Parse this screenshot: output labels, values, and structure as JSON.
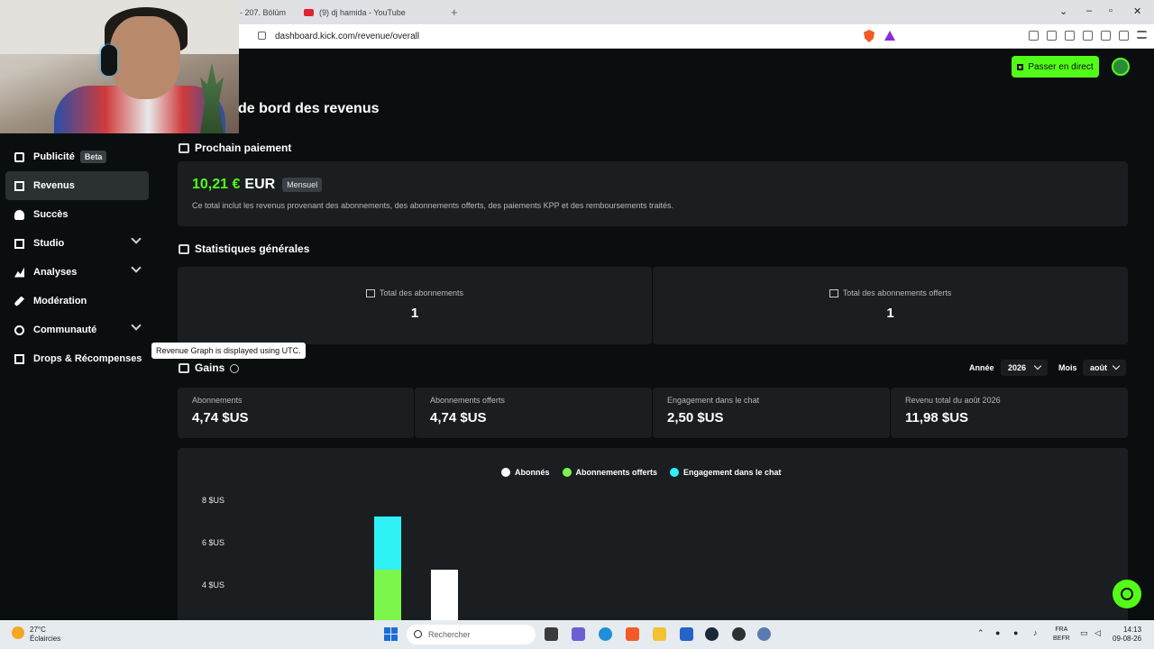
{
  "browser": {
    "tabs": [
      {
        "label": "- 207. Bölüm"
      },
      {
        "label": "(9) dj hamida - YouTube"
      }
    ],
    "url": "dashboard.kick.com/revenue/overall"
  },
  "header": {
    "live_button": "Passer en direct",
    "page_title": "de bord des revenus"
  },
  "sidebar": {
    "items": [
      {
        "label": "Publicité",
        "badge": "Beta"
      },
      {
        "label": "Revenus"
      },
      {
        "label": "Succès"
      },
      {
        "label": "Studio"
      },
      {
        "label": "Analyses"
      },
      {
        "label": "Modération"
      },
      {
        "label": "Communauté"
      },
      {
        "label": "Drops & Récompenses"
      }
    ]
  },
  "next_payment": {
    "title": "Prochain paiement",
    "amount": "10,21 €",
    "currency": "EUR",
    "period": "Mensuel",
    "description": "Ce total inclut les revenus provenant des abonnements, des abonnements offerts, des paiements KPP et des remboursements traités."
  },
  "general_stats": {
    "title": "Statistiques générales",
    "items": [
      {
        "label": "Total des abonnements",
        "value": "1"
      },
      {
        "label": "Total des abonnements offerts",
        "value": "1"
      }
    ]
  },
  "earnings": {
    "title": "Gains",
    "tooltip": "Revenue Graph is displayed using UTC.",
    "year_label": "Année",
    "year_value": "2026",
    "month_label": "Mois",
    "month_value": "août",
    "items": [
      {
        "label": "Abonnements",
        "value": "4,74 $US"
      },
      {
        "label": "Abonnements offerts",
        "value": "4,74 $US"
      },
      {
        "label": "Engagement dans le chat",
        "value": "2,50 $US"
      },
      {
        "label": "Revenu total du août 2026",
        "value": "11,98 $US"
      }
    ]
  },
  "chart_data": {
    "type": "bar",
    "title": "",
    "xlabel": "",
    "ylabel": "",
    "ytick_labels": [
      "8 $US",
      "6 $US",
      "4 $US"
    ],
    "ylim": [
      0,
      8
    ],
    "stacked": true,
    "series": [
      {
        "name": "Abonnés",
        "color": "#ffffff",
        "values": [
          0,
          4.74
        ]
      },
      {
        "name": "Abonnements offerts",
        "color": "#7cf64a",
        "values": [
          4.74,
          0
        ]
      },
      {
        "name": "Engagement dans le chat",
        "color": "#2ef2f6",
        "values": [
          2.5,
          0
        ]
      }
    ]
  },
  "taskbar": {
    "weather_temp": "27°C",
    "weather_desc": "Éclaircies",
    "search_placeholder": "Rechercher",
    "lang_1": "FRA",
    "lang_2": "BEFR",
    "time": "14:13",
    "date": "09-08-26"
  },
  "colors": {
    "accent": "#53fc18",
    "background": "#0b0e0f",
    "card": "#1a1e20"
  }
}
